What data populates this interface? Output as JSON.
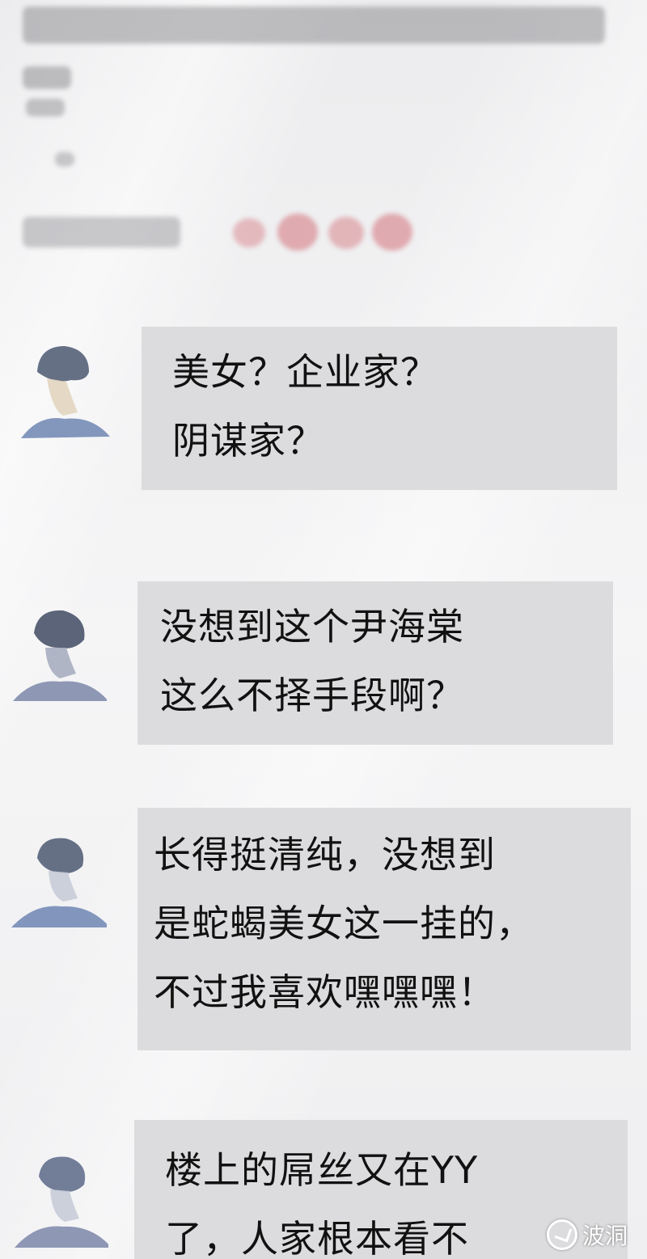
{
  "comments": [
    {
      "avatar": "user-avatar-icon",
      "lines": [
        "美女？企业家？",
        "阴谋家？"
      ]
    },
    {
      "avatar": "user-avatar-icon",
      "lines": [
        "没想到这个尹海棠",
        "这么不择手段啊？"
      ]
    },
    {
      "avatar": "user-avatar-icon",
      "lines": [
        "长得挺清纯，没想到",
        "是蛇蝎美女这一挂的，",
        "不过我喜欢嘿嘿嘿！"
      ]
    },
    {
      "avatar": "user-avatar-icon",
      "lines": [
        "楼上的屌丝又在YY",
        "了，人家根本看不"
      ]
    }
  ],
  "watermark": {
    "icon": "bodong-logo-icon",
    "text": "波洞"
  },
  "colors": {
    "bubble": "#dcdcde",
    "text": "#111111",
    "avatar_blue": "#6f86b3",
    "avatar_dark": "#4b5871",
    "blurred_pink": "#d98d94"
  }
}
